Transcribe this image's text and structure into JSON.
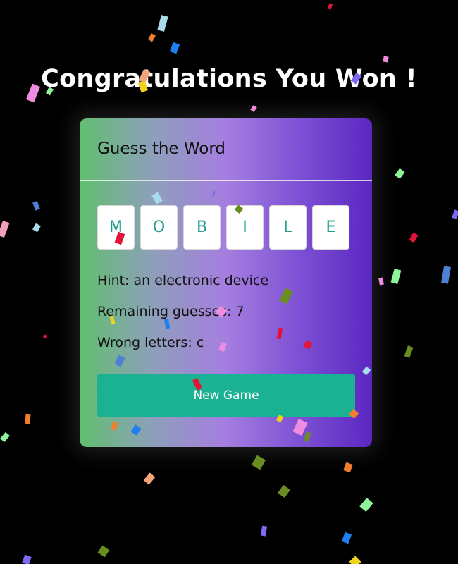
{
  "header": {
    "title": "Congratulations You Won !"
  },
  "game": {
    "title": "Guess the Word",
    "word_letters": [
      "M",
      "O",
      "B",
      "I",
      "L",
      "E"
    ],
    "hint": "Hint: an electronic device",
    "remaining_guesses": "Remaining guesses: 7",
    "wrong_letters": "Wrong letters: c",
    "new_game_label": "New Game"
  },
  "colors": {
    "background": "#000000",
    "button": "#1bb193",
    "letter": "#1f9e8d"
  }
}
